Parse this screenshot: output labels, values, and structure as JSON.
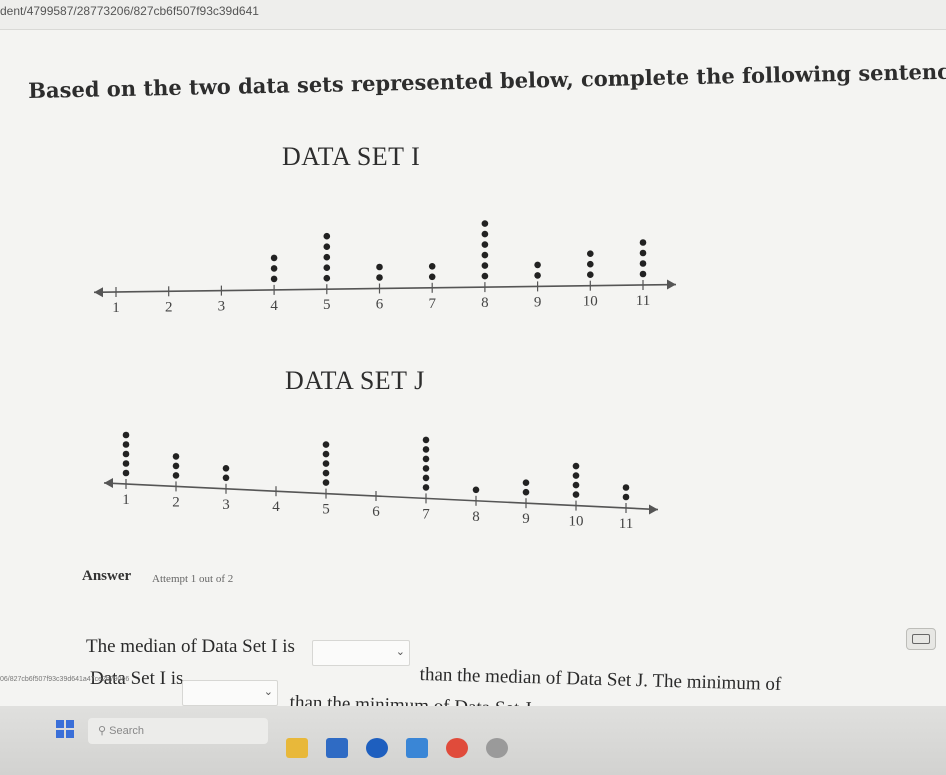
{
  "url": "dent/4799587/28773206/827cb6f507f93c39d641",
  "instructions": "Based on the two data sets represented below, complete the following sentences.",
  "chart_data": [
    {
      "type": "scatter",
      "title": "DATA SET I",
      "tick_labels": [
        "1",
        "2",
        "3",
        "4",
        "5",
        "6",
        "7",
        "8",
        "9",
        "10",
        "11"
      ],
      "dot_counts": [
        0,
        0,
        0,
        3,
        5,
        2,
        2,
        6,
        2,
        3,
        4
      ],
      "xlim": [
        1,
        11
      ]
    },
    {
      "type": "scatter",
      "title": "DATA SET J",
      "tick_labels": [
        "1",
        "2",
        "3",
        "4",
        "5",
        "6",
        "7",
        "8",
        "9",
        "10",
        "11"
      ],
      "dot_counts": [
        5,
        3,
        2,
        0,
        5,
        0,
        6,
        1,
        2,
        4,
        2
      ],
      "xlim": [
        1,
        11
      ]
    }
  ],
  "answer": {
    "label": "Answer",
    "attempt": "Attempt 1 out of 2"
  },
  "sentences": {
    "s1_part1": "The median of Data Set I is",
    "s1_part2": "than the median of Data Set J. The minimum of",
    "s2_part1": "Data Set I is",
    "s2_part2": "than the minimum of Data Set J."
  },
  "dropdowns": {
    "dd1_value": "",
    "dd2_value": "",
    "chevron": "chevron-down-icon"
  },
  "side_url": "06/827cb6f507f93c39d641a47ce2b790e6",
  "taskbar": {
    "search_placeholder": "Search"
  },
  "icons": {
    "keyboard": "keyboard-icon",
    "windows": "windows-logo-icon",
    "search": "search-icon"
  }
}
